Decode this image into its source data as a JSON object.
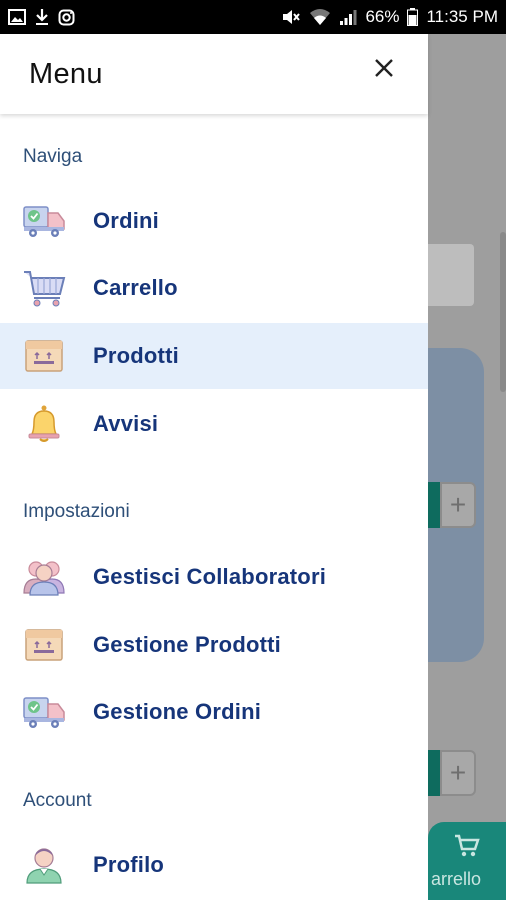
{
  "status_bar": {
    "battery": "66%",
    "time": "11:35 PM",
    "left_icons": [
      "image-icon",
      "download-icon",
      "instagram-icon"
    ],
    "right_icons": [
      "mute-icon",
      "wifi-icon",
      "signal-icon",
      "battery-icon"
    ]
  },
  "drawer": {
    "title": "Menu",
    "close_icon": "close-icon",
    "sections": [
      {
        "label": "Naviga",
        "items": [
          {
            "label": "Ordini",
            "icon": "truck-icon"
          },
          {
            "label": "Carrello",
            "icon": "cart-icon"
          },
          {
            "label": "Prodotti",
            "icon": "box-icon",
            "active": true
          },
          {
            "label": "Avvisi",
            "icon": "bell-icon"
          }
        ]
      },
      {
        "label": "Impostazioni",
        "items": [
          {
            "label": "Gestisci Collaboratori",
            "icon": "users-icon"
          },
          {
            "label": "Gestione Prodotti",
            "icon": "box-icon"
          },
          {
            "label": "Gestione Ordini",
            "icon": "truck-icon"
          }
        ]
      },
      {
        "label": "Account",
        "items": [
          {
            "label": "Profilo",
            "icon": "user-icon"
          }
        ]
      }
    ]
  },
  "background": {
    "plus_label": "+",
    "cart_button_label": "arrello",
    "cart_icon": "cart-icon"
  },
  "colors": {
    "accent_text": "#16357a",
    "section_text": "#2e4f78",
    "active_bg": "#e5effb",
    "cart_button": "#19877a"
  }
}
